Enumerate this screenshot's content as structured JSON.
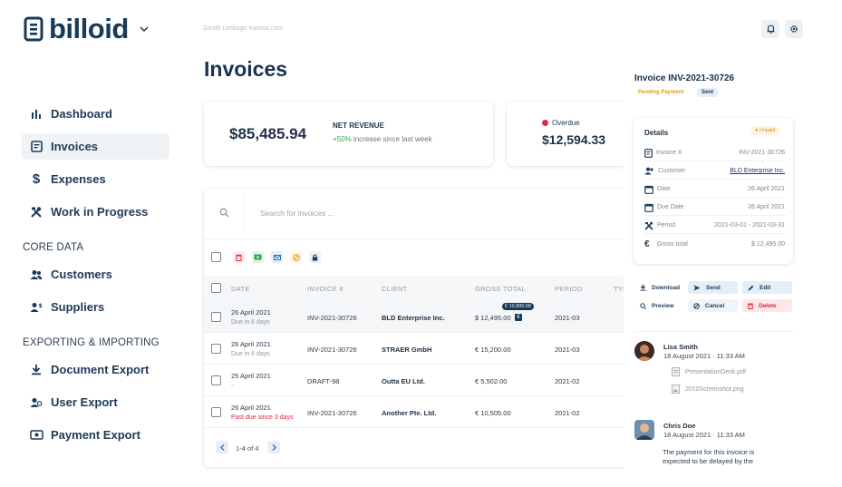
{
  "app": {
    "logo_text": "billoid"
  },
  "sidebar": {
    "items": [
      {
        "label": "Dashboard",
        "icon": "bar-chart-icon",
        "active": false
      },
      {
        "label": "Invoices",
        "icon": "invoice-icon",
        "active": true
      },
      {
        "label": "Expenses",
        "icon": "dollar-icon",
        "active": false
      },
      {
        "label": "Work in Progress",
        "icon": "tools-icon",
        "active": false
      }
    ],
    "core_title": "CORE DATA",
    "core_items": [
      {
        "label": "Customers",
        "icon": "users-icon"
      },
      {
        "label": "Suppliers",
        "icon": "supplier-icon"
      }
    ],
    "export_title": "EXPORTING & IMPORTING",
    "export_items": [
      {
        "label": "Document Export",
        "icon": "download-icon"
      },
      {
        "label": "User Export",
        "icon": "user-export-icon"
      },
      {
        "label": "Payment Export",
        "icon": "payment-icon"
      }
    ]
  },
  "header": {
    "breadcrumb": "Zenith Limbago Karena.com",
    "title": "Invoices"
  },
  "stats": {
    "revenue_value": "$85,485.94",
    "revenue_label": "NET REVENUE",
    "revenue_change": "+50%",
    "revenue_change_text": "increase since last week",
    "overdue_label": "Overdue",
    "overdue_value": "$12,594.33"
  },
  "search": {
    "placeholder": "Search for invoices ..."
  },
  "table": {
    "headers": [
      "DATE",
      "INVOICE #",
      "CLIENT",
      "GROSS TOTAL",
      "PERIOD",
      "TYP"
    ],
    "rows": [
      {
        "date": "26 April 2021",
        "note": "Due in 6 days",
        "note_red": false,
        "invoice": "INV-2021-30726",
        "client": "BLD Enterprise Inc.",
        "gross": "$ 12,495.00",
        "period": "2021-03",
        "tag": "€ 10,890.00"
      },
      {
        "date": "26 April 2021",
        "note": "Due in 6 days",
        "note_red": false,
        "invoice": "INV-2021-30726",
        "client": "STRAER GmbH",
        "gross": "€ 15,200.00",
        "period": "2021-03",
        "tag": ""
      },
      {
        "date": "25 April 2021",
        "note": "-",
        "note_red": false,
        "invoice": "DRAFT-98",
        "client": "Outta EU Ltd.",
        "gross": "€ 5,502.00",
        "period": "2021-02",
        "tag": ""
      },
      {
        "date": "26 April 2021",
        "note": "Past due since 3 days",
        "note_red": true,
        "invoice": "INV-2021-30726",
        "client": "Another Pte. Ltd.",
        "gross": "€ 10,505.00",
        "period": "2021-02",
        "tag": ""
      }
    ],
    "pagination": "1-4 of 4"
  },
  "panel": {
    "title": "Invoice INV-2021-30726",
    "status_pending": "Pending Payment",
    "status_sent": "Sent",
    "details_title": "Details",
    "unpaid_badge": "Unpaid",
    "details": [
      {
        "label": "Invoice #",
        "value": "INV-2021-30726",
        "link": false,
        "icon": "invoice-icon"
      },
      {
        "label": "Customer",
        "value": "BLD Enterprise Inc.",
        "link": true,
        "icon": "users-icon"
      },
      {
        "label": "Date",
        "value": "26 April 2021",
        "link": false,
        "icon": "calendar-icon"
      },
      {
        "label": "Due Date",
        "value": "26 April 2021",
        "link": false,
        "icon": "calendar-icon"
      },
      {
        "label": "Period",
        "value": "2021-03-01 - 2021-03-31",
        "link": false,
        "icon": "tools-icon"
      },
      {
        "label": "Gross total",
        "value": "$ 12,495.00",
        "link": false,
        "icon": "euro-icon"
      }
    ],
    "actions": {
      "download": "Download",
      "send": "Send",
      "edit": "Edit",
      "preview": "Preview",
      "cancel": "Cancel",
      "delete": "Delete"
    },
    "comments": [
      {
        "name": "Lisa Smith",
        "date": "18 August 2021 · 11:33 AM",
        "files": [
          "PresentationDeck.pdf",
          "2010Screenshot.png"
        ]
      },
      {
        "name": "Chris Doe",
        "date": "18 August 2021 · 11:33 AM",
        "text": "The payment for this invoice is expected to be delayed by the"
      }
    ]
  },
  "colors": {
    "brand": "#173a57",
    "overdue_dot": "#e0283f",
    "positive": "#2fa84f",
    "pending": "#e29b12"
  }
}
